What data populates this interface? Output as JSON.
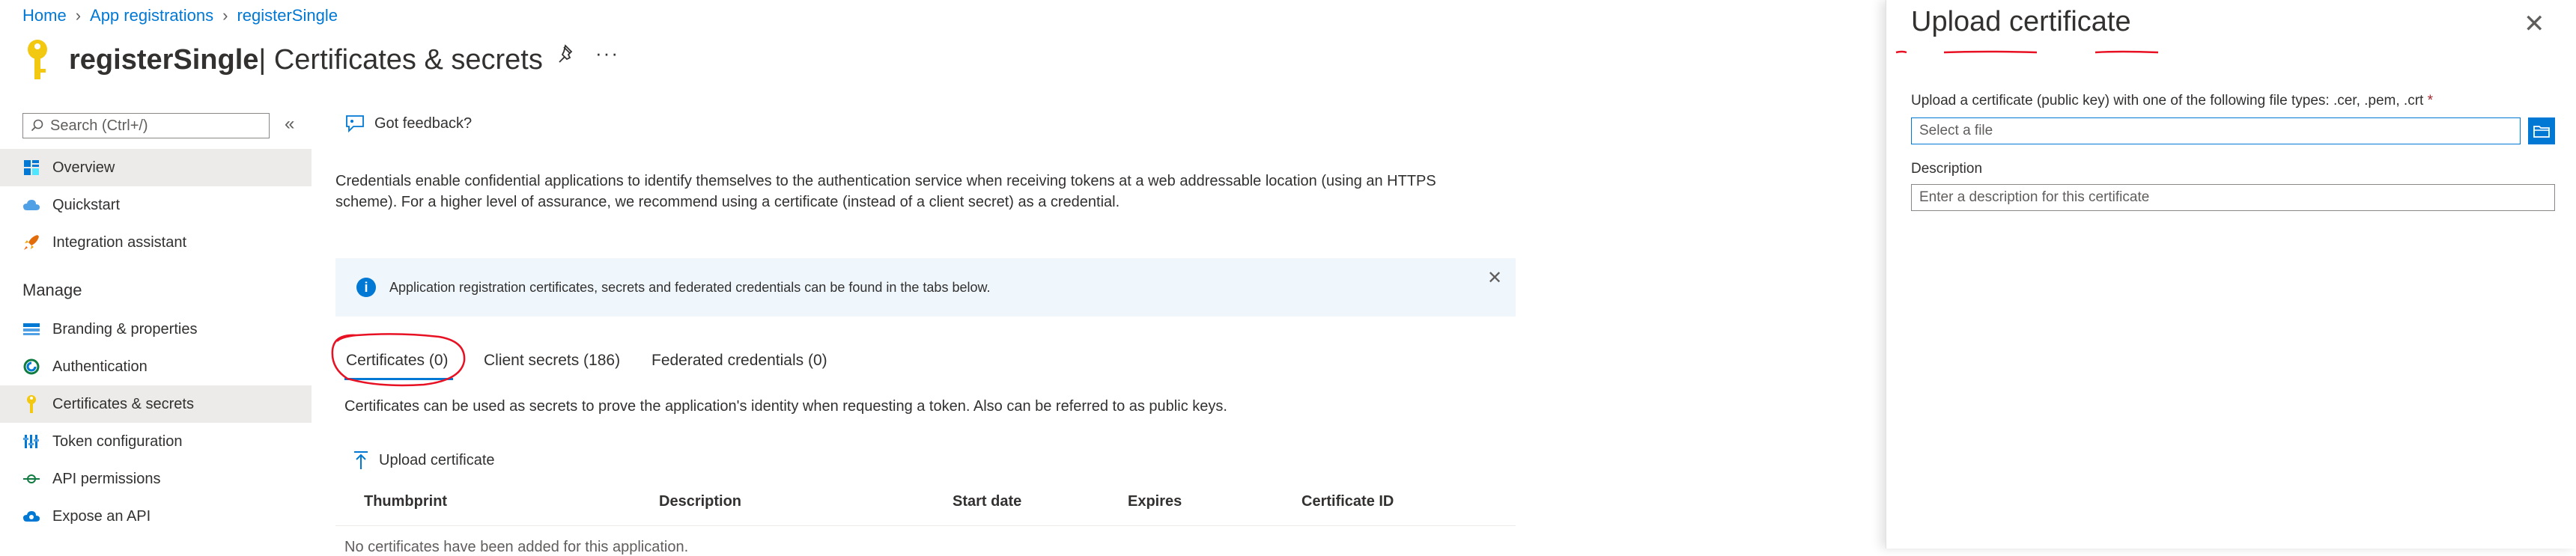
{
  "breadcrumb": {
    "home": "Home",
    "app_registrations": "App registrations",
    "current": "registerSingle"
  },
  "header": {
    "app_name": "registerSingle",
    "page_title": " | Certificates & secrets",
    "more": "···"
  },
  "sidebar": {
    "search_placeholder": "Search (Ctrl+/)",
    "collapse": "«",
    "items": [
      {
        "label": "Overview",
        "icon": "grid-icon"
      },
      {
        "label": "Quickstart",
        "icon": "cloud-icon"
      },
      {
        "label": "Integration assistant",
        "icon": "rocket-icon"
      }
    ],
    "section_manage": "Manage",
    "manage_items": [
      {
        "label": "Branding & properties",
        "icon": "branding-icon"
      },
      {
        "label": "Authentication",
        "icon": "authentication-icon"
      },
      {
        "label": "Certificates & secrets",
        "icon": "key-icon"
      },
      {
        "label": "Token configuration",
        "icon": "token-bars-icon"
      },
      {
        "label": "API permissions",
        "icon": "api-permissions-icon"
      },
      {
        "label": "Expose an API",
        "icon": "cloud-api-icon"
      }
    ]
  },
  "main": {
    "feedback": "Got feedback?",
    "description_line1": "Credentials enable confidential applications to identify themselves to the authentication service when receiving tokens at a web addressable location (using an HTTPS",
    "description_line2": "scheme). For a higher level of assurance, we recommend using a certificate (instead of a client secret) as a credential.",
    "banner_text": "Application registration certificates, secrets and federated credentials can be found in the tabs below.",
    "banner_close": "✕",
    "tabs": [
      {
        "label": "Certificates (0)"
      },
      {
        "label": "Client secrets (186)"
      },
      {
        "label": "Federated credentials (0)"
      }
    ],
    "tab_note": "Certificates can be used as secrets to prove the application's identity when requesting a token. Also can be referred to as public keys.",
    "upload_label": "Upload certificate",
    "columns": [
      "Thumbprint",
      "Description",
      "Start date",
      "Expires",
      "Certificate ID"
    ],
    "empty_row": "No certificates have been added for this application."
  },
  "panel": {
    "title": "Upload certificate",
    "close": "✕",
    "file_label": "Upload a certificate (public key) with one of the following file types: .cer, .pem, .crt",
    "required_mark": "*",
    "file_placeholder": "Select a file",
    "description_label": "Description",
    "description_placeholder": "Enter a description for this certificate"
  },
  "colors": {
    "accent": "#0078d4",
    "annotation_red": "#e81123",
    "selected_nav": "#edebe9",
    "banner_bg": "#eff6fc"
  }
}
